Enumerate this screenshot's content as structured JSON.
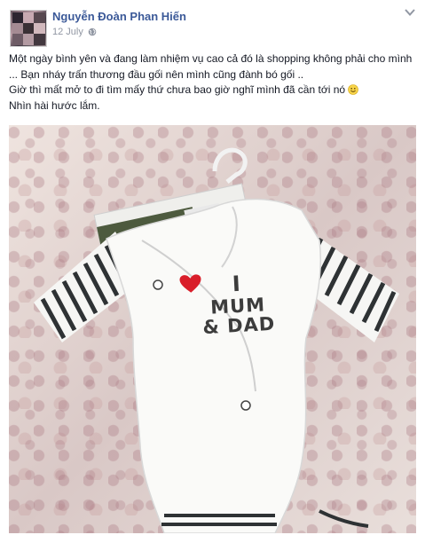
{
  "post": {
    "author_name": "Nguyễn Đoàn Phan Hiến",
    "date": "12 July",
    "audience_icon": "globe-icon",
    "menu_icon": "chevron-down-icon",
    "text_lines": [
      "Một ngày bình yên và đang làm nhiệm vụ cao cả đó là shopping không phải cho mình ... Bạn nháy trấn thương đầu gối nên mình cũng đành bó gối ..",
      "Giờ thì mất mở to đi tìm mấy thứ chưa bao giờ nghĩ mình đã cần tới nó",
      "Nhìn hài hước lắm."
    ],
    "emoji_icon": "smile-icon",
    "link_color": "#3b5998"
  },
  "photo": {
    "print_line1": "I",
    "print_line2": "MUM",
    "print_line3": "& DAD",
    "heart_color": "#d91e2a"
  }
}
